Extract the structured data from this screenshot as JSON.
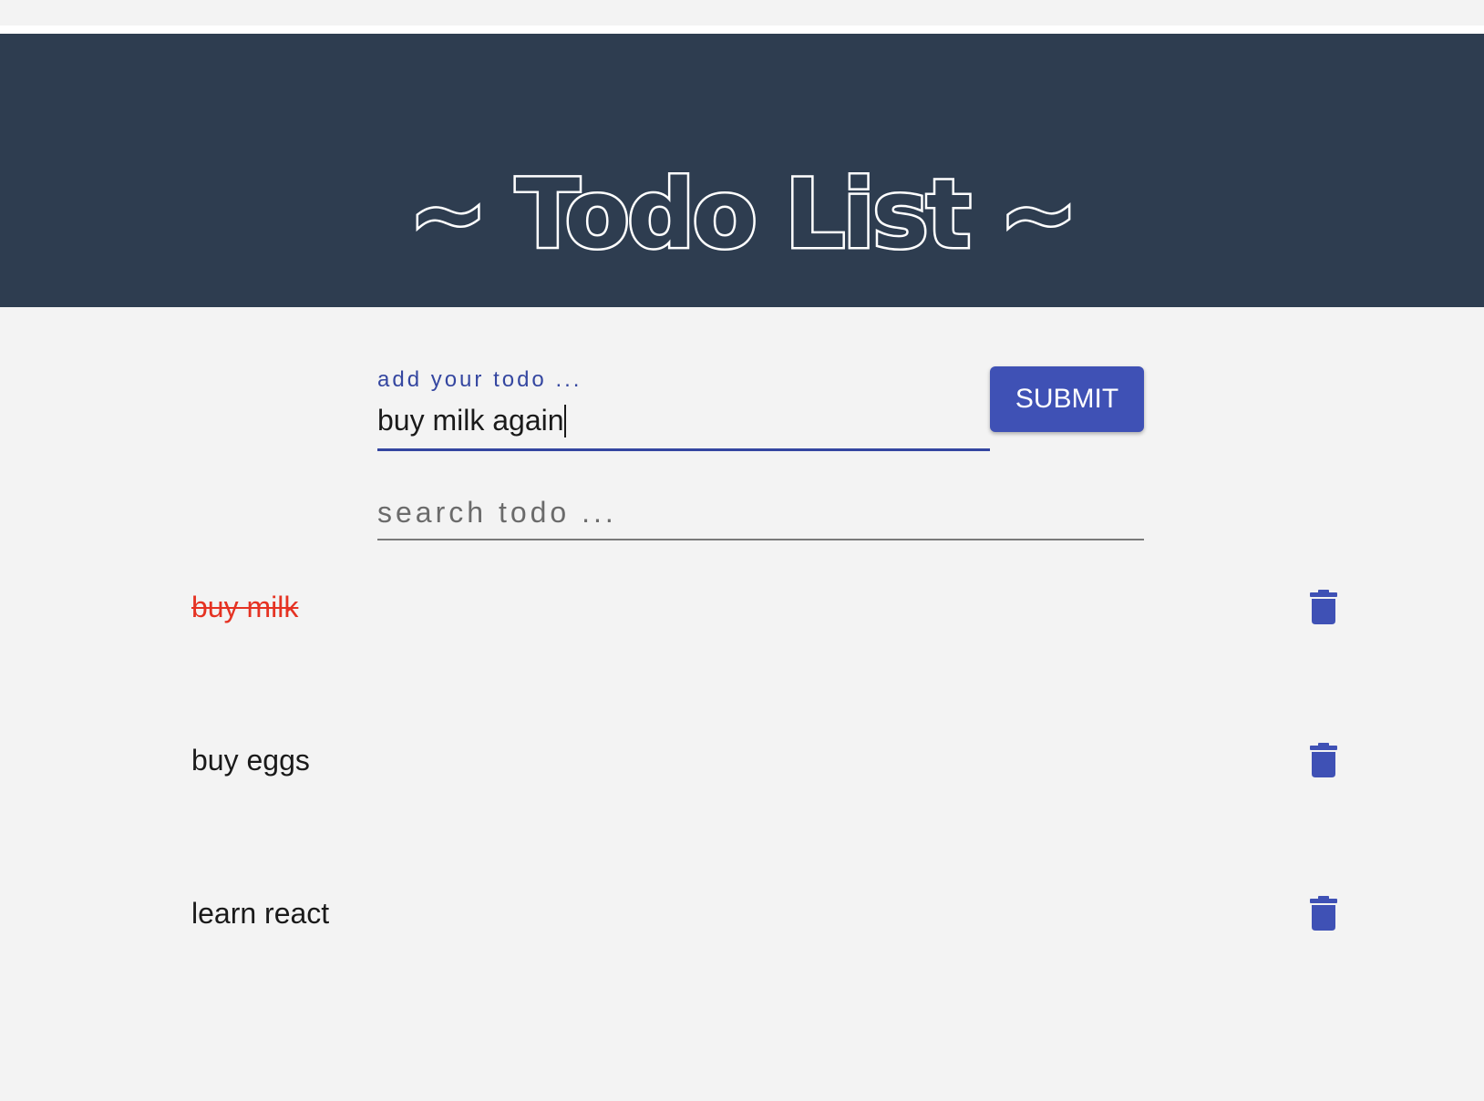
{
  "header": {
    "title": "~ Todo List ~"
  },
  "form": {
    "label": "add your todo ...",
    "input_value": "buy milk again",
    "submit_label": "SUBMIT"
  },
  "search": {
    "placeholder": "search todo ...",
    "value": ""
  },
  "todos": [
    {
      "text": "buy milk",
      "completed": true
    },
    {
      "text": "buy eggs",
      "completed": false
    },
    {
      "text": "learn react",
      "completed": false
    }
  ],
  "colors": {
    "header_bg": "#2e3d50",
    "accent": "#3f51b5",
    "completed_text": "#e53222",
    "page_bg": "#f3f3f3"
  },
  "icons": {
    "delete": "trash-icon"
  }
}
